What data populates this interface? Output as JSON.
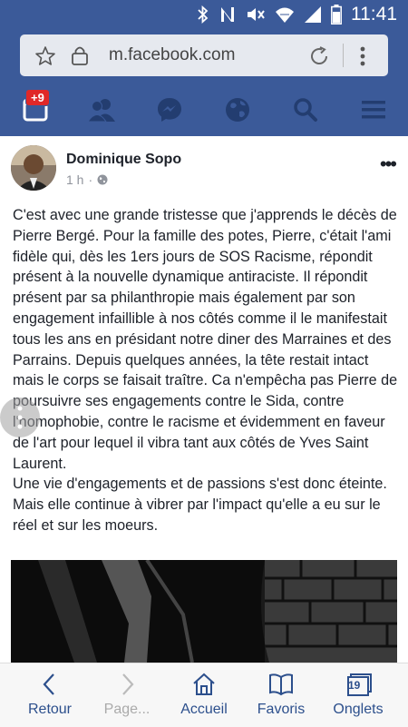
{
  "status_bar": {
    "time": "11:41",
    "icons": [
      "bluetooth-icon",
      "nfc-icon",
      "mute-icon",
      "wifi-icon",
      "signal-icon",
      "battery-icon"
    ]
  },
  "browser": {
    "url": "m.facebook.com",
    "icons": [
      "star-icon",
      "lock-icon",
      "reload-icon",
      "overflow-menu-icon"
    ]
  },
  "fb_nav": {
    "notification_count": "+9",
    "items": [
      "news-feed-icon",
      "friends-icon",
      "messenger-icon",
      "globe-icon",
      "search-icon",
      "menu-icon"
    ]
  },
  "post": {
    "author": "Dominique Sopo",
    "time": "1 h",
    "privacy_icon": "public-globe-icon",
    "text": "C'est avec une grande tristesse que j'apprends le décès de Pierre Bergé. Pour la famille des potes, Pierre, c'était l'ami fidèle qui, dès les 1ers jours de SOS Racisme, répondit présent à la nouvelle dynamique antiraciste. Il répondit présent par sa philanthropie mais également par son engagement infaillible à nos côtés comme il le manifestait tous les ans en présidant notre diner des Marraines et des Parrains. Depuis quelques années, la tête restait intact mais le corps se faisait traître. Ca n'empêcha pas Pierre de poursuivre ses engagements contre le Sida, contre l'homophobie, contre le racisme et évidemment en faveur de l'art pour lequel il vibra tant aux côtés de Yves Saint Laurent.\nUne vie d'engagements et de passions s'est donc éteinte. Mais elle continue à vibrer par l'impact qu'elle a eu sur le réel et sur les moeurs."
  },
  "bottom_bar": {
    "back": "Retour",
    "forward": "Page...",
    "home": "Accueil",
    "bookmarks": "Favoris",
    "tabs": "Onglets",
    "tab_count": "19"
  },
  "colors": {
    "facebook_blue": "#3b5a99",
    "bottom_accent": "#2c4f8c"
  }
}
